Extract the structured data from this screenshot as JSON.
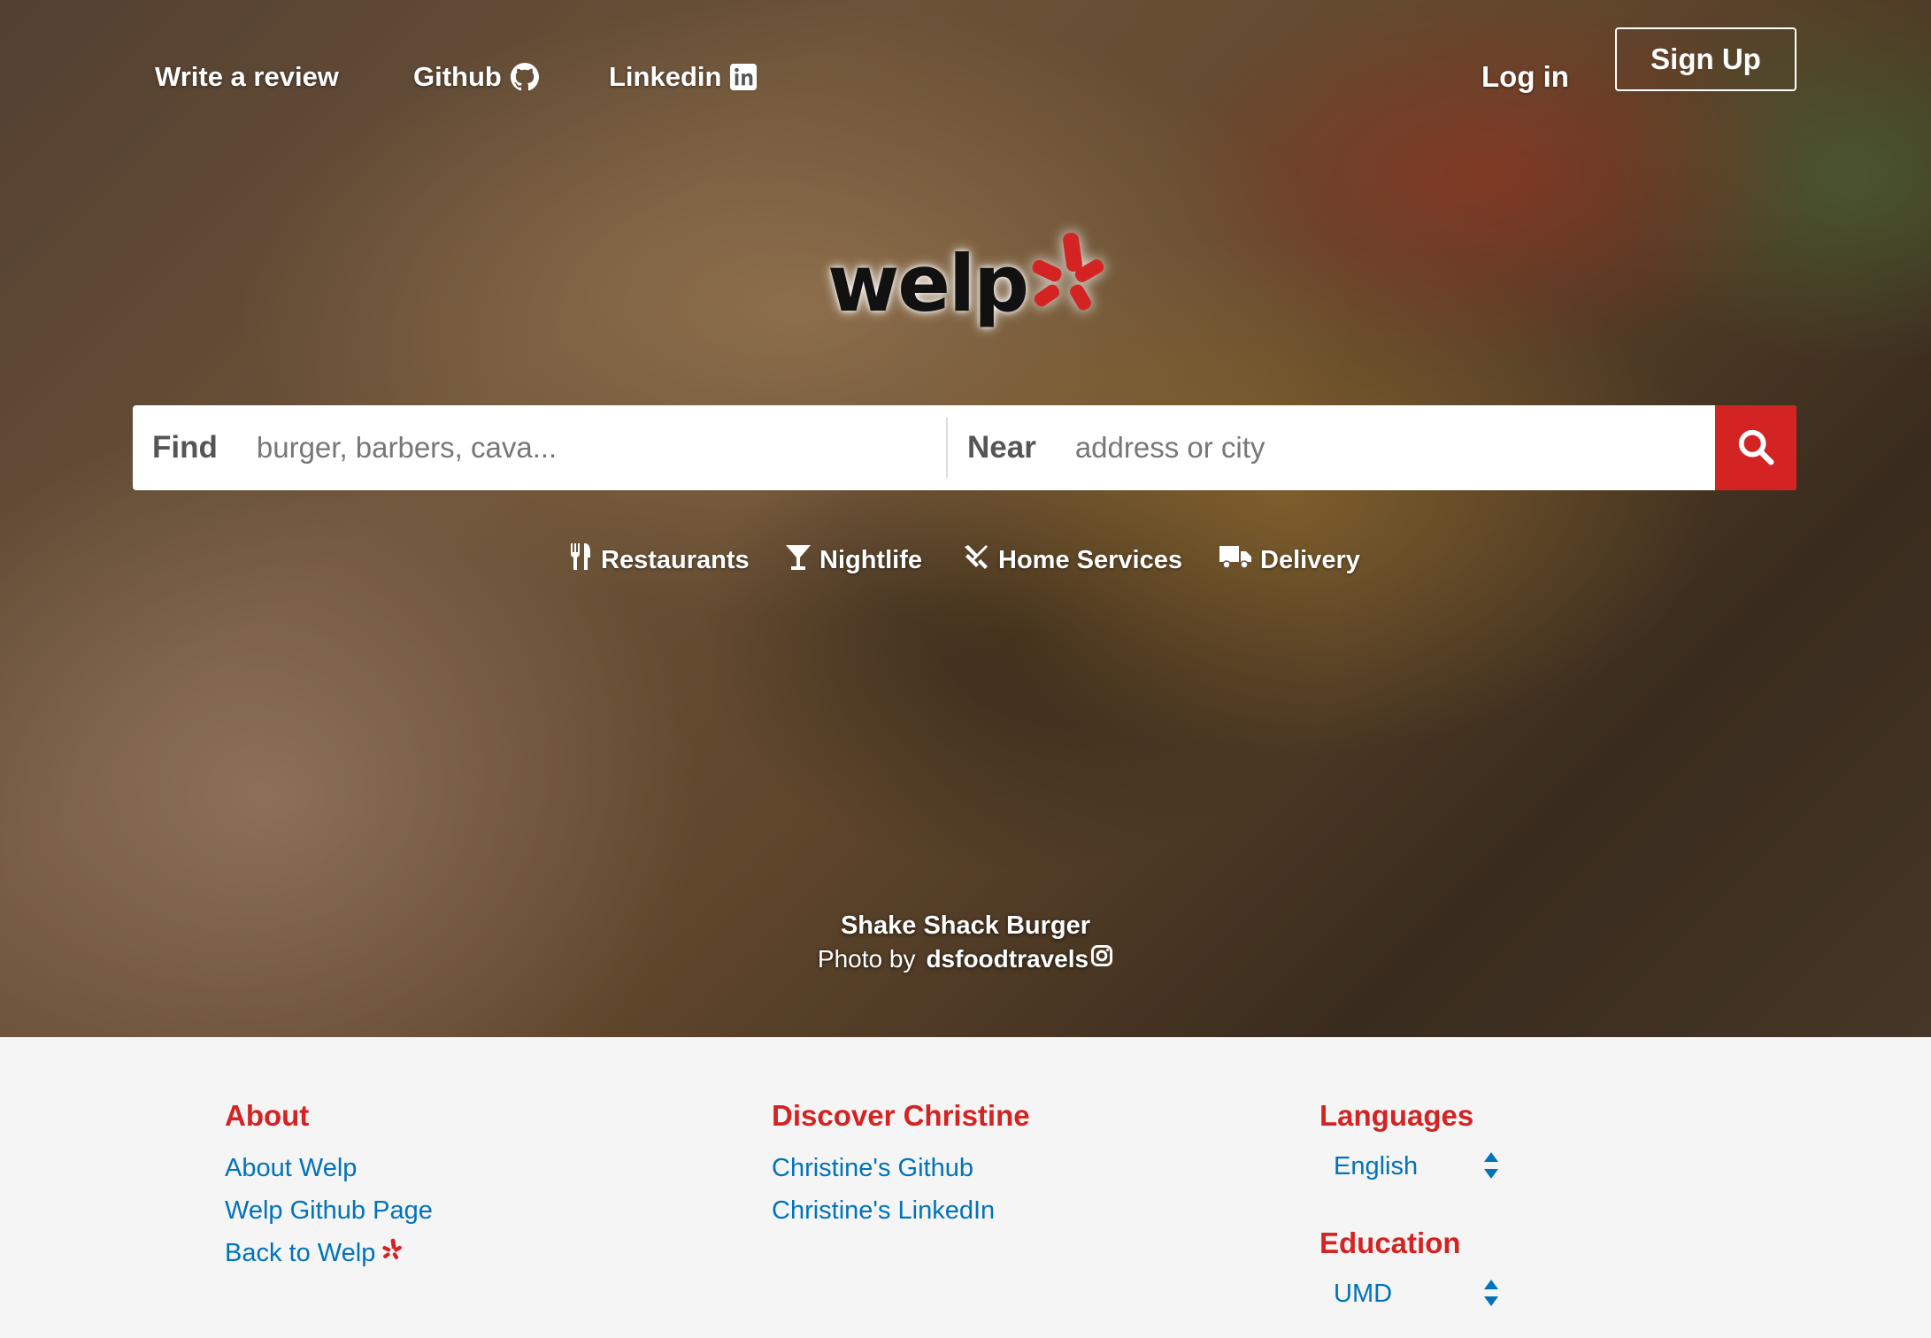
{
  "nav": {
    "write_review": "Write a review",
    "github": "Github",
    "linkedin": "Linkedin",
    "login": "Log in",
    "signup": "Sign Up"
  },
  "logo": {
    "text": "welp"
  },
  "search": {
    "find_label": "Find",
    "find_placeholder": "burger, barbers, cava...",
    "near_label": "Near",
    "near_placeholder": "address or city"
  },
  "categories": [
    {
      "label": "Restaurants",
      "icon": "fork-knife-icon"
    },
    {
      "label": "Nightlife",
      "icon": "cocktail-icon"
    },
    {
      "label": "Home Services",
      "icon": "tools-icon"
    },
    {
      "label": "Delivery",
      "icon": "truck-icon"
    }
  ],
  "photo_credit": {
    "title": "Shake Shack Burger",
    "prefix": "Photo by",
    "user": "dsfoodtravels"
  },
  "footer": {
    "about": {
      "heading": "About",
      "links": [
        "About Welp",
        "Welp Github Page",
        "Back to Welp"
      ]
    },
    "discover": {
      "heading": "Discover Christine",
      "links": [
        "Christine's Github",
        "Christine's LinkedIn"
      ]
    },
    "languages": {
      "heading": "Languages",
      "selected": "English"
    },
    "education": {
      "heading": "Education",
      "selected": "UMD"
    }
  },
  "colors": {
    "brand_red": "#d32323",
    "link_blue": "#0073bb",
    "footer_bg": "#f5f5f5"
  }
}
